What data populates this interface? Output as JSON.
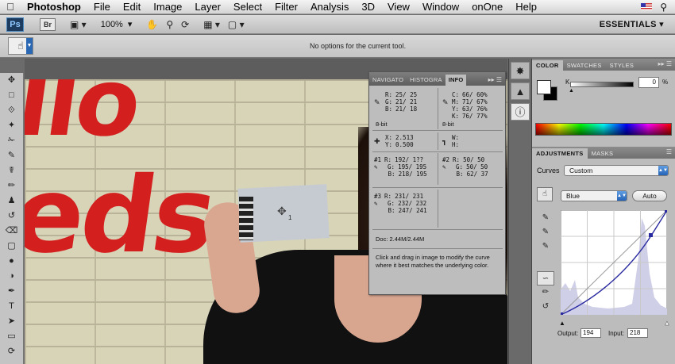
{
  "menubar": {
    "apple": "",
    "items": [
      "Photoshop",
      "File",
      "Edit",
      "Image",
      "Layer",
      "Select",
      "Filter",
      "Analysis",
      "3D",
      "View",
      "Window",
      "onOne",
      "Help"
    ]
  },
  "appbar": {
    "ps_label": "Ps",
    "br_label": "Br",
    "zoom": "100%",
    "workspace": "ESSENTIALS"
  },
  "options_bar": {
    "message": "No options for the current tool."
  },
  "canvas_text": {
    "line1": "llo",
    "line2": "eds",
    "sampler_number": "1"
  },
  "info_panel": {
    "tabs": [
      "NAVIGATO",
      "HISTOGRA",
      "INFO"
    ],
    "active_tab": "INFO",
    "rgb": {
      "r": "25/ 25",
      "g": "21/ 21",
      "b": "21/ 18",
      "depth": "8-bit"
    },
    "cmyk": {
      "c": "66/ 60%",
      "m": "71/ 67%",
      "y": "63/ 76%",
      "k": "76/ 77%",
      "depth": "8-bit"
    },
    "pos": {
      "x": "2.513",
      "y": "0.500"
    },
    "size": {
      "w_label": "W:",
      "h_label": "H:"
    },
    "s1": {
      "label": "#1",
      "r": "192/ 1??",
      "g": "195/ 195",
      "b": "218/ 195"
    },
    "s2": {
      "label": "#2",
      "r": "50/ 50",
      "g": "50/ 50",
      "b": "62/ 37"
    },
    "s3": {
      "label": "#3",
      "r": "231/ 231",
      "g": "232/ 232",
      "b": "247/ 241"
    },
    "doc": "Doc: 2.44M/2.44M",
    "hint": "Click and drag in image to modify the curve where it best matches the underlying color."
  },
  "color_panel": {
    "tabs": [
      "COLOR",
      "SWATCHES",
      "STYLES"
    ],
    "k_label": "K",
    "k_value": "0",
    "k_unit": "%"
  },
  "adjustments_panel": {
    "tabs": [
      "ADJUSTMENTS",
      "MASKS"
    ],
    "curves_label": "Curves",
    "preset": "Custom",
    "channel": "Blue",
    "auto_label": "Auto",
    "output_label": "Output:",
    "output_value": "194",
    "input_label": "Input:",
    "input_value": "218"
  },
  "colors": {
    "accent_blue": "#2563b6",
    "canvas_red": "#d41f1f",
    "curve_line": "#2a2aa0"
  }
}
